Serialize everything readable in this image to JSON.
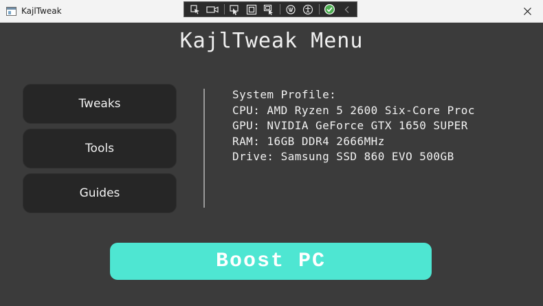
{
  "window": {
    "title": "KajlTweak",
    "icon": "app-window-icon",
    "close_icon": "close-icon"
  },
  "debug_toolbar": {
    "icons": [
      "select-element-icon",
      "video-icon",
      "pointer-select-icon",
      "layout-adorner-icon",
      "track-focus-icon",
      "binding-failures-icon",
      "accessibility-icon",
      "checkmark-icon",
      "collapse-chevron-icon"
    ]
  },
  "header": {
    "title": "KajlTweak Menu"
  },
  "nav": {
    "items": [
      {
        "label": "Tweaks"
      },
      {
        "label": "Tools"
      },
      {
        "label": "Guides"
      }
    ]
  },
  "profile": {
    "heading": "System Profile:",
    "cpu": "CPU: AMD Ryzen 5 2600 Six-Core Proc",
    "gpu": "GPU: NVIDIA GeForce GTX 1650 SUPER",
    "ram": "RAM: 16GB DDR4 2666MHz",
    "drive": "Drive: Samsung SSD 860 EVO 500GB"
  },
  "boost": {
    "label": "Boost PC"
  },
  "colors": {
    "background": "#3b3b3b",
    "nav_button": "#262626",
    "accent": "#4ee6d2",
    "text": "#f2f2f2",
    "check_green": "#4caf50"
  }
}
